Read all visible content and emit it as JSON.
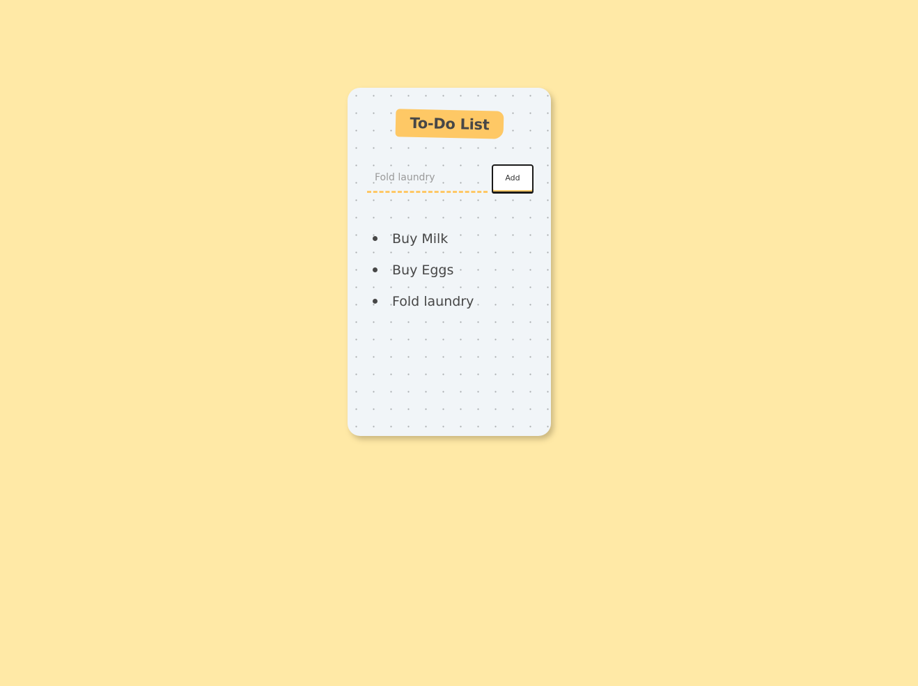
{
  "app": {
    "title": "To-Do List"
  },
  "input": {
    "value": "",
    "placeholder": "Fold laundry"
  },
  "buttons": {
    "add_label": "Add"
  },
  "tasks": [
    {
      "label": "Buy Milk"
    },
    {
      "label": "Buy Eggs"
    },
    {
      "label": "Fold laundry"
    }
  ],
  "colors": {
    "page_background": "#ffe9a6",
    "card_background": "#f1f5f8",
    "accent": "#fec865",
    "text": "#474747"
  }
}
